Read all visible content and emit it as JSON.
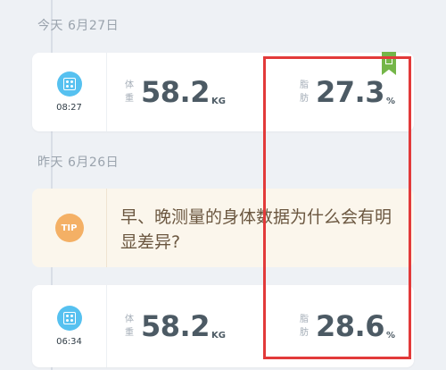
{
  "timeline": {
    "groups": [
      {
        "date": "今天 6月27日",
        "entries": [
          {
            "time": "08:27",
            "weight": {
              "label_top": "体",
              "label_bottom": "重",
              "value": "58.2",
              "unit": "KG"
            },
            "fat": {
              "label_top": "脂",
              "label_bottom": "肪",
              "value": "27.3",
              "unit": "%"
            }
          }
        ]
      },
      {
        "date": "昨天 6月26日",
        "tip": {
          "badge": "TIP",
          "text": "早、晚测量的身体数据为什么会有明显差异?"
        },
        "entries": [
          {
            "time": "06:34",
            "weight": {
              "label_top": "体",
              "label_bottom": "重",
              "value": "58.2",
              "unit": "KG"
            },
            "fat": {
              "label_top": "脂",
              "label_bottom": "肪",
              "value": "28.6",
              "unit": "%"
            }
          }
        ]
      }
    ]
  },
  "colors": {
    "scale_icon": "#56c1f0",
    "tip_icon": "#f4b065",
    "badge": "#74b648",
    "highlight": "#e23a3a"
  },
  "icons": {
    "scale": "scale-icon",
    "badge": "bookmark-badge-icon"
  }
}
